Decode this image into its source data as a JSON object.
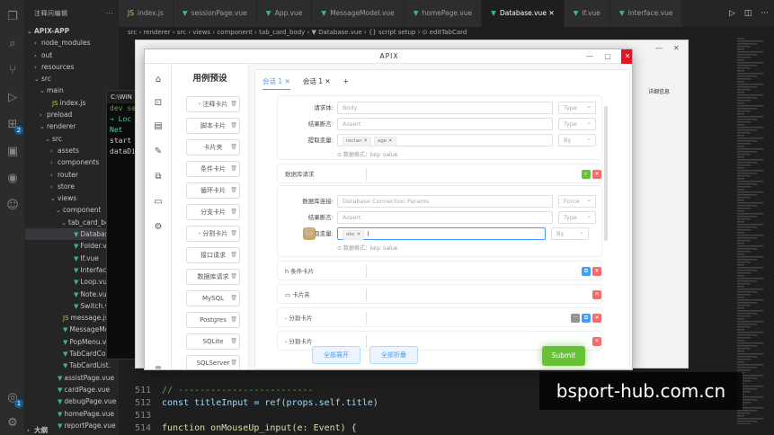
{
  "explorer": {
    "header": "注释问编辑",
    "project": "APIX-APP",
    "tree": [
      {
        "label": "node_modules",
        "depth": 0,
        "arrow": "›",
        "type": "folder"
      },
      {
        "label": "out",
        "depth": 0,
        "arrow": "›",
        "type": "folder"
      },
      {
        "label": "resources",
        "depth": 0,
        "arrow": "›",
        "type": "folder"
      },
      {
        "label": "src",
        "depth": 0,
        "arrow": "⌄",
        "type": "folder"
      },
      {
        "label": "main",
        "depth": 1,
        "arrow": "⌄",
        "type": "folder"
      },
      {
        "label": "index.js",
        "depth": 2,
        "arrow": "",
        "type": "js"
      },
      {
        "label": "preload",
        "depth": 1,
        "arrow": "›",
        "type": "folder"
      },
      {
        "label": "renderer",
        "depth": 1,
        "arrow": "⌄",
        "type": "folder"
      },
      {
        "label": "src",
        "depth": 2,
        "arrow": "⌄",
        "type": "folder"
      },
      {
        "label": "assets",
        "depth": 3,
        "arrow": "›",
        "type": "folder"
      },
      {
        "label": "components",
        "depth": 3,
        "arrow": "›",
        "type": "folder"
      },
      {
        "label": "router",
        "depth": 3,
        "arrow": "›",
        "type": "folder"
      },
      {
        "label": "store",
        "depth": 3,
        "arrow": "›",
        "type": "folder"
      },
      {
        "label": "views",
        "depth": 3,
        "arrow": "⌄",
        "type": "folder"
      },
      {
        "label": "component",
        "depth": 4,
        "arrow": "⌄",
        "type": "folder"
      },
      {
        "label": "tab_card_bo",
        "depth": 5,
        "arrow": "⌄",
        "type": "folder"
      },
      {
        "label": "Database.v",
        "depth": 6,
        "arrow": "",
        "type": "vue",
        "selected": true
      },
      {
        "label": "Folder.vue",
        "depth": 6,
        "arrow": "",
        "type": "vue"
      },
      {
        "label": "If.vue",
        "depth": 6,
        "arrow": "",
        "type": "vue"
      },
      {
        "label": "Interface.vue",
        "depth": 6,
        "arrow": "",
        "type": "vue"
      },
      {
        "label": "Loop.vue",
        "depth": 6,
        "arrow": "",
        "type": "vue"
      },
      {
        "label": "Note.vue",
        "depth": 6,
        "arrow": "",
        "type": "vue"
      },
      {
        "label": "Switch.vue",
        "depth": 6,
        "arrow": "",
        "type": "vue"
      },
      {
        "label": "message.js",
        "depth": 4,
        "arrow": "",
        "type": "js"
      },
      {
        "label": "MessageMo",
        "depth": 4,
        "arrow": "",
        "type": "vue"
      },
      {
        "label": "PopMenu.vu",
        "depth": 4,
        "arrow": "",
        "type": "vue"
      },
      {
        "label": "TabCardCom",
        "depth": 4,
        "arrow": "",
        "type": "vue"
      },
      {
        "label": "TabCardList.",
        "depth": 4,
        "arrow": "",
        "type": "vue"
      },
      {
        "label": "assistPage.vue",
        "depth": 3,
        "arrow": "",
        "type": "vue"
      },
      {
        "label": "cardPage.vue",
        "depth": 3,
        "arrow": "",
        "type": "vue"
      },
      {
        "label": "debugPage.vue",
        "depth": 3,
        "arrow": "",
        "type": "vue"
      },
      {
        "label": "homePage.vue",
        "depth": 3,
        "arrow": "",
        "type": "vue"
      },
      {
        "label": "reportPage.vue",
        "depth": 3,
        "arrow": "",
        "type": "vue"
      }
    ],
    "outline": "大纲"
  },
  "tabs": [
    {
      "label": "index.js",
      "icon": "JS",
      "active": false
    },
    {
      "label": "sessionPage.vue",
      "icon": "▼",
      "active": false
    },
    {
      "label": "App.vue",
      "icon": "▼",
      "active": false
    },
    {
      "label": "MessageModel.vue",
      "icon": "▼",
      "active": false
    },
    {
      "label": "homePage.vue",
      "icon": "▼",
      "active": false
    },
    {
      "label": "Database.vue",
      "icon": "▼",
      "active": true
    },
    {
      "label": "If.vue",
      "icon": "▼",
      "active": false
    },
    {
      "label": "Interface.vue",
      "icon": "▼",
      "active": false
    }
  ],
  "breadcrumb": "src › renderer › src › views › component › tab_card_body › ▼ Database.vue › {} script setup › ⊙ editTabCard",
  "code": [
    {
      "n": "511",
      "html": "cm",
      "text": "// -------------------------"
    },
    {
      "n": "512",
      "text": "const titleInput = ref(props.self.title)"
    },
    {
      "n": "513",
      "text": ""
    },
    {
      "n": "514",
      "text": "function onMouseUp_input(e: Event) {"
    }
  ],
  "terminal": {
    "title": "C:\\WIN",
    "lines": [
      "dev serv",
      "",
      "→ Loc",
      "  Net",
      "start el",
      "",
      "dataDir:"
    ]
  },
  "bgwin": {
    "btn": "详细信息"
  },
  "apix": {
    "title": "APIX",
    "preset_title": "用例预设",
    "presets": [
      "- 注释卡片",
      "脚本卡片",
      "卡片夹",
      "条件卡片",
      "循环卡片",
      "分支卡片",
      "- 分割卡片",
      "接口请求",
      "数据库请求",
      "MySQL",
      "Postgres",
      "SQLite",
      "SQLServer"
    ],
    "session_tabs": [
      {
        "label": "会话 1",
        "active": true
      },
      {
        "label": "会话 1",
        "active": false
      }
    ],
    "session_add": "+",
    "card1": {
      "rows": [
        {
          "label": "请求体:",
          "value": "Body",
          "select": "Type"
        },
        {
          "label": "结果断言:",
          "value": "Assert",
          "select": "Type"
        },
        {
          "label": "提取变量:",
          "chips": [
            "rectan",
            "age"
          ],
          "select": "By"
        }
      ],
      "hint": "⊙ 数据格式：key: value"
    },
    "db_header": "数据库请求",
    "card2": {
      "rows": [
        {
          "label": "数据库连接:",
          "value": "Database Connection Params",
          "select": "Force"
        },
        {
          "label": "结果断言:",
          "value": "Assert",
          "select": "Type"
        },
        {
          "label": "提取变量:",
          "chips": [
            "abc"
          ],
          "select": "By"
        }
      ],
      "hint": "⊙ 数据格式：key: value"
    },
    "collapsed": [
      {
        "label": "h 条件卡片"
      },
      {
        "label": "▭ 卡片夹"
      },
      {
        "label": "- 分割卡片"
      },
      {
        "label": "- 分割卡片"
      }
    ],
    "expand_all": "全部展开",
    "collapse_all": "全部折叠",
    "submit": "Submit"
  },
  "watermark": "bsport-hub.com.cn"
}
